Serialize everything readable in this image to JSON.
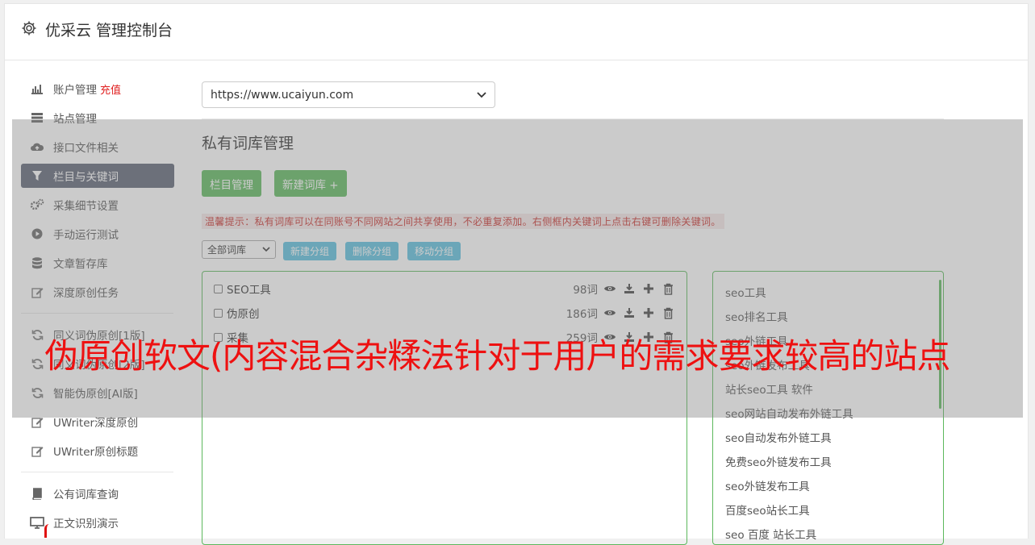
{
  "app": {
    "title": "优采云 管理控制台"
  },
  "sidebar": {
    "items": [
      {
        "label": "账户管理",
        "badge": "充值",
        "icon": "bar-chart-icon",
        "active": false
      },
      {
        "label": "站点管理",
        "icon": "server-icon",
        "active": false
      },
      {
        "label": "接口文件相关",
        "icon": "cloud-upload-icon",
        "active": false
      },
      {
        "label": "栏目与关键词",
        "icon": "filter-icon",
        "active": true
      },
      {
        "label": "采集细节设置",
        "icon": "gears-icon",
        "active": false
      },
      {
        "label": "手动运行测试",
        "icon": "play-circle-icon",
        "active": false
      },
      {
        "label": "文章暂存库",
        "icon": "database-icon",
        "active": false
      },
      {
        "label": "深度原创任务",
        "icon": "edit-icon",
        "active": false
      },
      {
        "label": "同义词伪原创[1版]",
        "icon": "refresh-icon",
        "active": false
      },
      {
        "label": "同义词伪原创[2版]",
        "icon": "refresh-icon",
        "active": false
      },
      {
        "label": "智能伪原创[AI版]",
        "icon": "refresh-icon",
        "active": false
      },
      {
        "label": "UWriter深度原创",
        "icon": "edit-icon",
        "active": false
      },
      {
        "label": "UWriter原创标题",
        "icon": "edit-icon",
        "active": false
      },
      {
        "label": "公有词库查询",
        "icon": "book-icon",
        "active": false
      },
      {
        "label": "正文识别演示",
        "icon": "monitor-icon",
        "active": false
      }
    ]
  },
  "main": {
    "site_select": "https://www.ucaiyun.com",
    "section_title": "私有词库管理",
    "btn_columns": "栏目管理",
    "btn_new_lib": "新建词库 +",
    "tip": "温馨提示：私有词库可以在同账号不同网站之间共享使用，不必重复添加。右侧框内关键词上点击右键可删除关键词。",
    "lib_select": "全部词库",
    "btn_new_group": "新建分组",
    "btn_delete_group": "删除分组",
    "btn_move_group": "移动分组",
    "groups": [
      {
        "name": "SEO工具",
        "count": "98词"
      },
      {
        "name": "伪原创",
        "count": "186词"
      },
      {
        "name": "采集",
        "count": "259词"
      }
    ],
    "keywords": [
      "seo工具",
      "seo排名工具",
      "seo外链工具",
      "seo外链发布工具",
      "站长seo工具 软件",
      "seo网站自动发布外链工具",
      "seo自动发布外链工具",
      "免费seo外链发布工具",
      "seo外链发布工具",
      "百度seo站长工具",
      "seo 百度 站长工具"
    ]
  },
  "overlay": {
    "headline": "伪原创软文(内容混合杂糅法针对于用户的需求要求较高的站点"
  },
  "colors": {
    "accent_green": "#5cb85c",
    "accent_blue": "#5bc0de",
    "active_nav": "#5c6274",
    "headline_red": "#ee1111"
  }
}
